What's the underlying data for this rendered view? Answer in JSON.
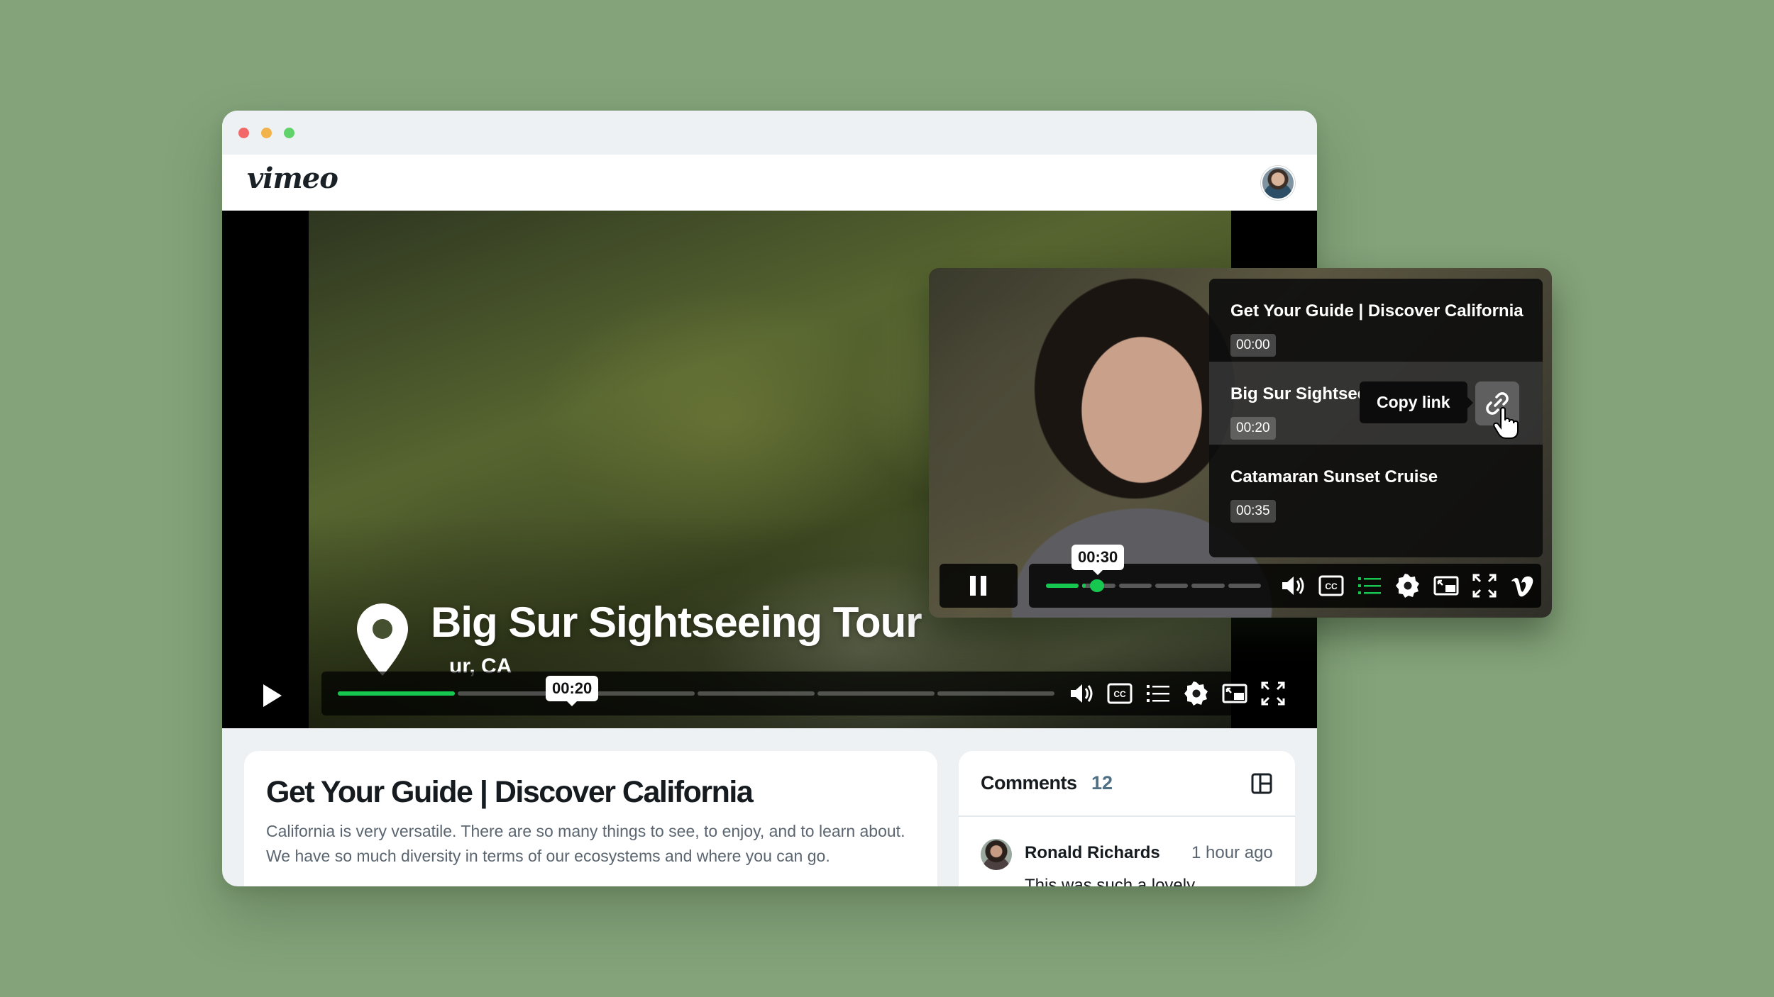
{
  "colors": {
    "accent": "#17c850",
    "background": "#84a37a",
    "count": "#4f6f85"
  },
  "window": {
    "controls": [
      "close",
      "minimize",
      "maximize"
    ]
  },
  "header": {
    "logo": "vimeo",
    "avatar_icon": "user-avatar"
  },
  "player": {
    "title": "Big Sur Sightseeing Tour",
    "subtitle": "Big Sur, CA",
    "visible_subtitle": "ur, CA",
    "current_time": "00:20",
    "progress_fraction": 0.167,
    "icons": [
      "play-icon",
      "volume-icon",
      "cc-icon",
      "chapters-icon",
      "settings-icon",
      "pip-icon",
      "fullscreen-icon"
    ]
  },
  "info": {
    "title": "Get Your Guide | Discover California",
    "description": "California is very versatile. There are so many things to see, to enjoy, and to learn about. We have so much diversity in terms of our ecosystems and where you can go."
  },
  "comments": {
    "label": "Comments",
    "count": "12",
    "items": [
      {
        "author": "Ronald Richards",
        "time": "1 hour ago",
        "text": "This was such a lovely"
      }
    ]
  },
  "mini_player": {
    "current_time": "00:30",
    "progress_fraction": 0.14,
    "chapters": [
      {
        "title": "Get Your Guide | Discover California",
        "time": "00:00"
      },
      {
        "title": "Big Sur Sightseeing Tour",
        "time": "00:20"
      },
      {
        "title": "Catamaran Sunset Cruise",
        "time": "00:35"
      }
    ],
    "copy_link_label": "Copy link",
    "icons": [
      "pause-icon",
      "volume-icon",
      "cc-icon",
      "chapters-icon",
      "settings-icon",
      "pip-icon",
      "fullscreen-icon",
      "vimeo-icon"
    ]
  }
}
